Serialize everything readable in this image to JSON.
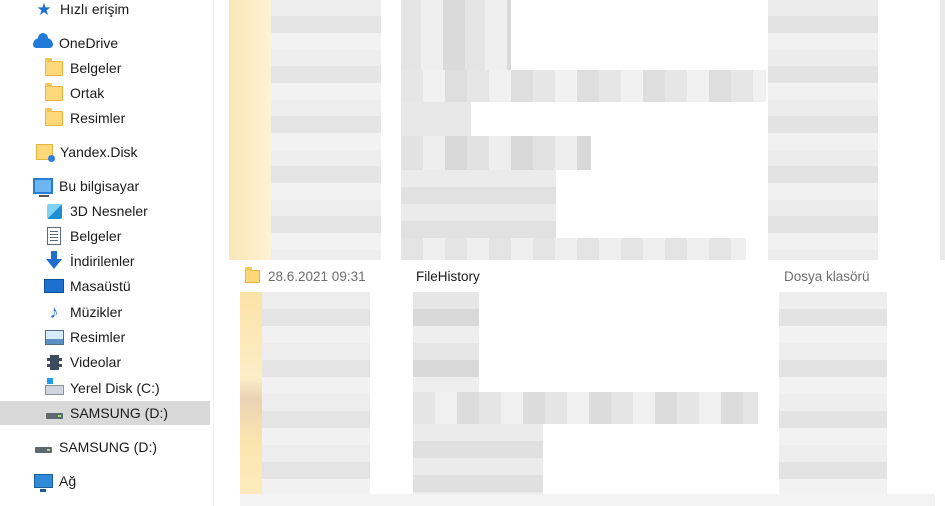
{
  "nav": {
    "items": [
      {
        "label": "Hızlı erişim",
        "icon": "star-icon"
      },
      {
        "label": "OneDrive",
        "icon": "cloud-icon"
      },
      {
        "label": "Belgeler",
        "icon": "folder-icon"
      },
      {
        "label": "Ortak",
        "icon": "folder-icon"
      },
      {
        "label": "Resimler",
        "icon": "folder-icon"
      },
      {
        "label": "Yandex.Disk",
        "icon": "yandex-folder-icon"
      },
      {
        "label": "Bu bilgisayar",
        "icon": "computer-icon"
      },
      {
        "label": "3D Nesneler",
        "icon": "cube-icon"
      },
      {
        "label": "Belgeler",
        "icon": "document-icon"
      },
      {
        "label": "İndirilenler",
        "icon": "download-arrow-icon"
      },
      {
        "label": "Masaüstü",
        "icon": "desktop-icon"
      },
      {
        "label": "Müzikler",
        "icon": "music-note-icon"
      },
      {
        "label": "Resimler",
        "icon": "picture-icon"
      },
      {
        "label": "Videolar",
        "icon": "film-icon"
      },
      {
        "label": "Yerel Disk (C:)",
        "icon": "windows-drive-icon"
      },
      {
        "label": "SAMSUNG (D:)",
        "icon": "drive-icon"
      },
      {
        "label": "SAMSUNG (D:)",
        "icon": "drive-icon"
      },
      {
        "label": "Ağ",
        "icon": "network-icon"
      }
    ]
  },
  "file_row": {
    "date": "28.6.2021 09:31",
    "name": "FileHistory",
    "type": "Dosya klasörü"
  }
}
